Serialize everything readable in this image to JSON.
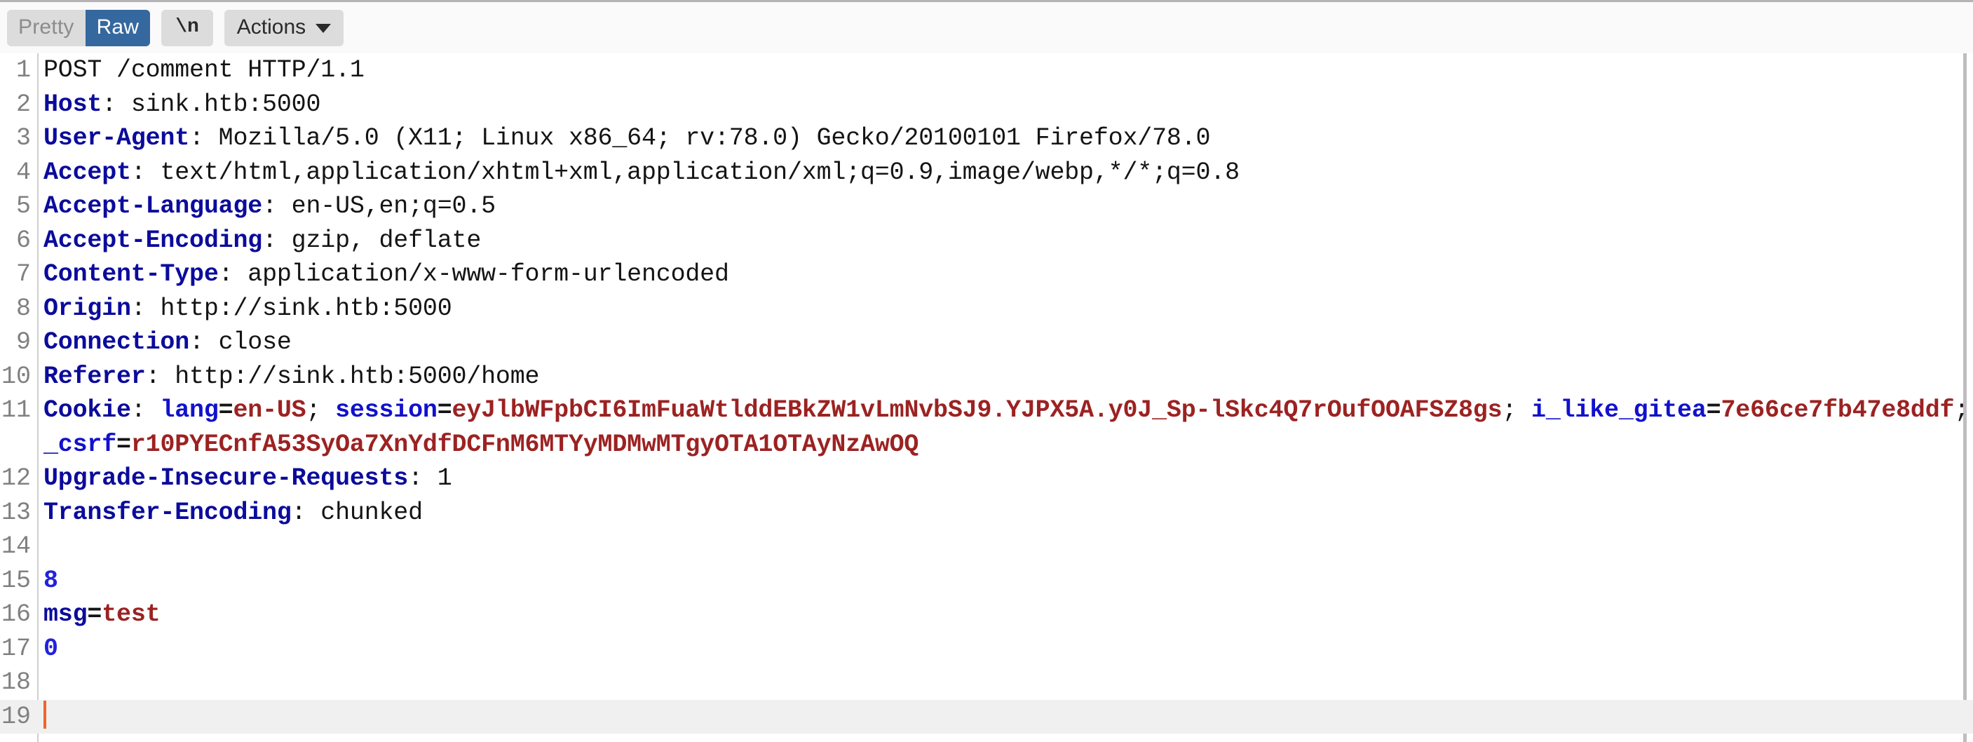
{
  "toolbar": {
    "pretty_label": "Pretty",
    "raw_label": "Raw",
    "newline_label": "\\n",
    "actions_label": "Actions",
    "chevron_icon": "chevron-down-icon",
    "active_view": "Raw",
    "accent_color": "#35689e",
    "inactive_bg": "#dcdcdc",
    "inactive_fg": "#8c8c8c"
  },
  "editor": {
    "colors": {
      "header_name": "#0b0b9c",
      "header_value": "#141414",
      "cookie_name": "#1111cc",
      "cookie_value": "#9c2222",
      "chunk_size": "#2222dd",
      "caret": "#f0642d",
      "current_line_bg": "#f0f0f0",
      "line_number": "#808080",
      "gutter_rule": "#cfcfcf"
    },
    "total_lines": 19,
    "current_line": 19,
    "line_numbers": [
      "1",
      "2",
      "3",
      "4",
      "5",
      "6",
      "7",
      "8",
      "9",
      "10",
      "11",
      "12",
      "13",
      "14",
      "15",
      "16",
      "17",
      "18",
      "19"
    ],
    "lines": [
      {
        "n": "1",
        "kind": "request-line",
        "text": "POST /comment HTTP/1.1",
        "method": "POST",
        "path": "/comment",
        "version": "HTTP/1.1"
      },
      {
        "n": "2",
        "kind": "header",
        "name": "Host",
        "value": "sink.htb:5000"
      },
      {
        "n": "3",
        "kind": "header",
        "name": "User-Agent",
        "value": "Mozilla/5.0 (X11; Linux x86_64; rv:78.0) Gecko/20100101 Firefox/78.0"
      },
      {
        "n": "4",
        "kind": "header",
        "name": "Accept",
        "value": "text/html,application/xhtml+xml,application/xml;q=0.9,image/webp,*/*;q=0.8"
      },
      {
        "n": "5",
        "kind": "header",
        "name": "Accept-Language",
        "value": "en-US,en;q=0.5"
      },
      {
        "n": "6",
        "kind": "header",
        "name": "Accept-Encoding",
        "value": "gzip, deflate"
      },
      {
        "n": "7",
        "kind": "header",
        "name": "Content-Type",
        "value": "application/x-www-form-urlencoded"
      },
      {
        "n": "8",
        "kind": "header",
        "name": "Origin",
        "value": "http://sink.htb:5000"
      },
      {
        "n": "9",
        "kind": "header",
        "name": "Connection",
        "value": "close"
      },
      {
        "n": "10",
        "kind": "header",
        "name": "Referer",
        "value": "http://sink.htb:5000/home"
      },
      {
        "n": "11",
        "kind": "cookie-header",
        "name": "Cookie",
        "cookies": [
          {
            "name": "lang",
            "value": "en-US"
          },
          {
            "name": "session",
            "value": "eyJlbWFpbCI6ImFuaWtlddEBkZW1vLmNvbSJ9.YJPX5A.y0J_Sp-lSkc4Q7rOufOOAFSZ8gs"
          },
          {
            "name": "i_like_gitea",
            "value": "7e66ce7fb47e8ddf"
          },
          {
            "name": "_csrf",
            "value": "r10PYECnfA53SyOa7XnYdfDCFnM6MTYyMDMwMTgyOTA1OTAyNzAwOQ"
          }
        ]
      },
      {
        "n": "12",
        "kind": "header",
        "name": "Upgrade-Insecure-Requests",
        "value": "1"
      },
      {
        "n": "13",
        "kind": "header",
        "name": "Transfer-Encoding",
        "value": "chunked"
      },
      {
        "n": "14",
        "kind": "blank",
        "text": ""
      },
      {
        "n": "15",
        "kind": "chunk-size",
        "text": "8"
      },
      {
        "n": "16",
        "kind": "body-param",
        "name": "msg",
        "value": "test"
      },
      {
        "n": "17",
        "kind": "chunk-size",
        "text": "0"
      },
      {
        "n": "18",
        "kind": "blank",
        "text": ""
      },
      {
        "n": "19",
        "kind": "caret",
        "text": ""
      }
    ]
  }
}
